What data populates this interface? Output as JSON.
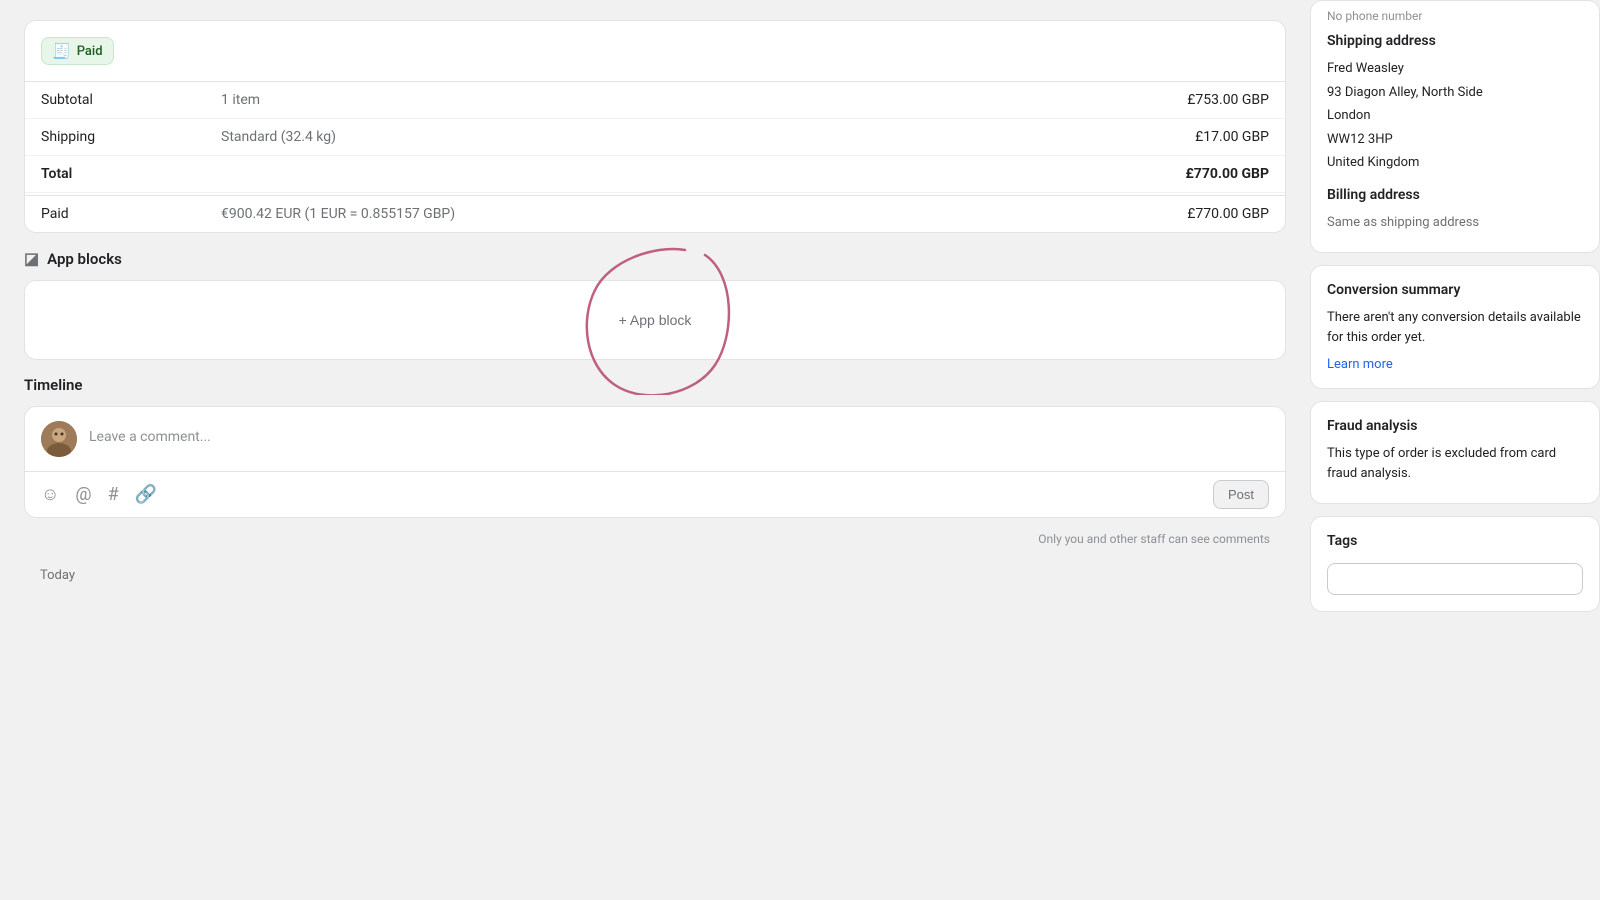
{
  "payment": {
    "badge": "Paid",
    "subtotal_label": "Subtotal",
    "subtotal_qty": "1 item",
    "subtotal_amount": "£753.00 GBP",
    "shipping_label": "Shipping",
    "shipping_description": "Standard (32.4 kg)",
    "shipping_amount": "£17.00 GBP",
    "total_label": "Total",
    "total_amount": "£770.00 GBP",
    "paid_label": "Paid",
    "paid_description": "€900.42 EUR (1 EUR = 0.855157 GBP)",
    "paid_amount": "£770.00 GBP"
  },
  "app_blocks": {
    "title": "App blocks",
    "add_button": "+ App block"
  },
  "timeline": {
    "title": "Timeline",
    "placeholder": "Leave a comment...",
    "post_button": "Post",
    "staff_note": "Only you and other staff can see comments",
    "today_label": "Today"
  },
  "sidebar": {
    "phone_partial": "No phone number",
    "shipping_address_title": "Shipping address",
    "shipping_name": "Fred Weasley",
    "shipping_street": "93 Diagon Alley, North Side",
    "shipping_city": "London",
    "shipping_postcode": "WW12 3HP",
    "shipping_country": "United Kingdom",
    "billing_address_title": "Billing address",
    "billing_same": "Same as shipping address",
    "conversion_title": "Conversion summary",
    "conversion_text": "There aren't any conversion details available for this order yet.",
    "learn_more": "Learn more",
    "fraud_title": "Fraud analysis",
    "fraud_text": "This type of order is excluded from card fraud analysis.",
    "tags_title": "Tags"
  }
}
